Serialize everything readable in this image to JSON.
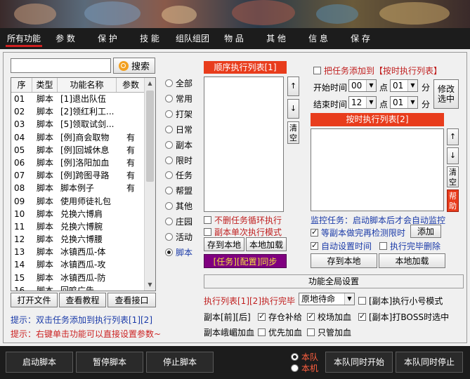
{
  "tabs": [
    "所有功能",
    "参 数",
    "保 护",
    "技 能",
    "组队组团",
    "物 品",
    "其 他",
    "信 息",
    "保 存"
  ],
  "search": {
    "value": "",
    "button_label": "搜索"
  },
  "table": {
    "headers": [
      "序",
      "类型",
      "功能名称",
      "参数"
    ],
    "rows": [
      [
        "01",
        "脚本",
        "[1]退出队伍",
        ""
      ],
      [
        "02",
        "脚本",
        "[2]领红利工...",
        ""
      ],
      [
        "03",
        "脚本",
        "[5]领取试剑...",
        ""
      ],
      [
        "04",
        "脚本",
        "[例]商会取物",
        "有"
      ],
      [
        "05",
        "脚本",
        "[例]回城休息",
        "有"
      ],
      [
        "06",
        "脚本",
        "[例]洛阳加血",
        "有"
      ],
      [
        "07",
        "脚本",
        "[例]跨图寻路",
        "有"
      ],
      [
        "08",
        "脚本",
        "脚本例子",
        "有"
      ],
      [
        "09",
        "脚本",
        "使用师徒礼包",
        ""
      ],
      [
        "10",
        "脚本",
        "兑换六博肩",
        ""
      ],
      [
        "11",
        "脚本",
        "兑换六博腕",
        ""
      ],
      [
        "12",
        "脚本",
        "兑换六博腰",
        ""
      ],
      [
        "13",
        "脚本",
        "冰镇西瓜-体",
        ""
      ],
      [
        "14",
        "脚本",
        "冰镇西瓜-攻",
        ""
      ],
      [
        "15",
        "脚本",
        "冰镇西瓜-防",
        ""
      ],
      [
        "16",
        "脚本",
        "回鸣广告",
        ""
      ]
    ]
  },
  "left_buttons": [
    "打开文件",
    "查看教程",
    "查看接口"
  ],
  "hints": [
    "提示：双击任务添加到执行列表[1][2]",
    "提示：右键单击功能可以直接设置参数~"
  ],
  "categories": [
    "全部",
    "常用",
    "打架",
    "日常",
    "副本",
    "限时",
    "任务",
    "帮盟",
    "其他",
    "庄园",
    "活动",
    "脚本"
  ],
  "selected_category": "脚本",
  "seq_list": {
    "title": "顺序执行列表[1]",
    "up": "↑",
    "down": "↓",
    "clear": "清空",
    "chk_no_delete": "不删任务循环执行",
    "chk_single": "副本单次执行模式",
    "save": "存到本地",
    "load": "本地加载",
    "sync": "[任务][配置]同步"
  },
  "timed": {
    "add_label": "把任务添加到【按时执行列表】",
    "start_label": "开始时间",
    "end_label": "结束时间",
    "hour_unit": "点",
    "min_unit": "分",
    "start_hour": "00",
    "start_min": "01",
    "end_hour": "12",
    "end_min": "01",
    "modify_btn": "修改选中",
    "title": "按时执行列表[2]",
    "up": "↑",
    "down": "↓",
    "clear": "清空",
    "help": "帮助",
    "monitor": "监控任务：启动脚本后才会自动监控",
    "chk_wait": "等副本做完再检测限时",
    "add_btn": "添加",
    "chk_auto_time": "自动设置时间",
    "chk_delete_done": "执行完毕删除",
    "save": "存到本地",
    "load": "本地加载"
  },
  "global": {
    "title": "功能全局设置",
    "exec_after_label": "执行列表[1][2]执行完毕",
    "exec_after_value": "原地待命",
    "chk_small_mode": "[副本]执行小号模式",
    "dungeon_label": "副本[前][后]",
    "chk_restock": "存仓补给",
    "chk_heal": "校场加血",
    "chk_boss": "[副本]打BOSS时选中",
    "chk_emei": "副本峨嵋加血",
    "chk_priority_heal": "优先加血",
    "chk_only_heal": "只管加血"
  },
  "bottom": {
    "start": "启动脚本",
    "pause": "暂停脚本",
    "stop": "停止脚本",
    "radio_team": "本队",
    "radio_machine": "本机",
    "team_start": "本队同时开始",
    "team_stop": "本队同时停止"
  },
  "colors": {
    "accent_red": "#e83c1c",
    "hint_blue": "#1a3aa8",
    "hint_red": "#cc2222",
    "sync_purple": "#800080",
    "sync_text": "#f0e040"
  }
}
